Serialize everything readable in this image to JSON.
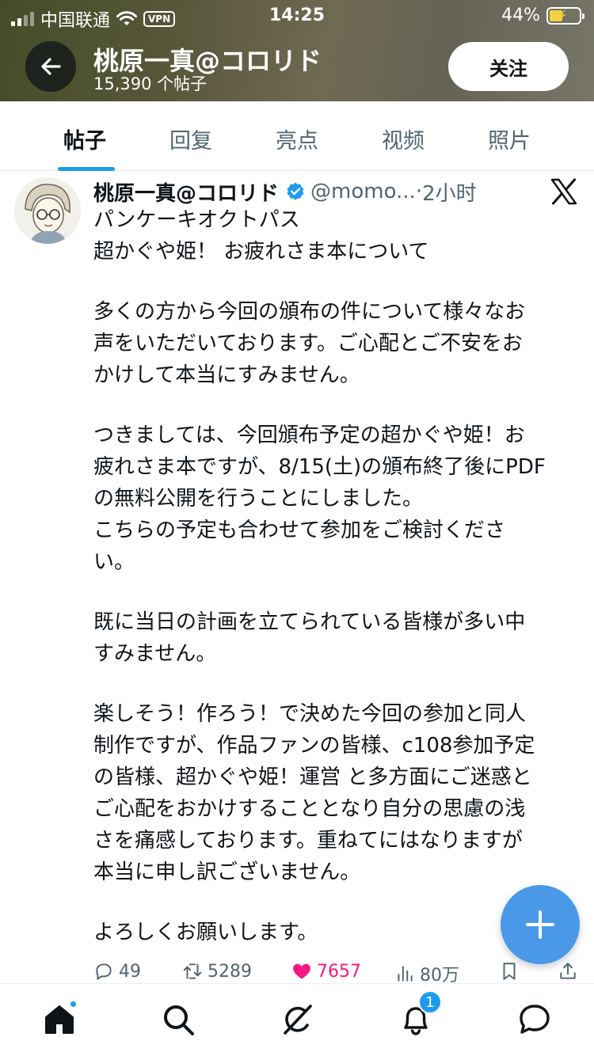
{
  "status_bar": {
    "carrier": "中国联通",
    "vpn": "VPN",
    "time": "14:25",
    "battery": "44%"
  },
  "header": {
    "profile_name": "桃原一真@コロリド",
    "post_count": "15,390 个帖子",
    "follow_label": "关注"
  },
  "tabs": [
    {
      "label": "帖子",
      "active": true
    },
    {
      "label": "回复",
      "active": false
    },
    {
      "label": "亮点",
      "active": false
    },
    {
      "label": "视频",
      "active": false
    },
    {
      "label": "照片",
      "active": false
    }
  ],
  "tweet": {
    "author": "桃原一真@コロリド",
    "handle": "@momo...",
    "dot": "·",
    "time": "2小时",
    "lines": [
      "パンケーキオクトパス",
      "超かぐや姫！ お疲れさま本について",
      "",
      "多くの方から今回の頒布の件について様々なお",
      "声をいただいております。ご心配とご不安をお",
      "かけして本当にすみません。",
      "",
      "つきましては、今回頒布予定の超かぐや姫！お",
      "疲れさま本ですが、8/15(土)の頒布終了後にPDF",
      "の無料公開を行うことにしました。",
      "こちらの予定も合わせて参加をご検討くださ",
      "い。",
      "",
      "既に当日の計画を立てられている皆様が多い中",
      "すみません。",
      "",
      "楽しそう！作ろう！で決めた今回の参加と同人",
      "制作ですが、作品ファンの皆様、c108参加予定",
      "の皆様、超かぐや姫！運営 と多方面にご迷惑と",
      "ご心配をおかけすることとなり自分の思慮の浅",
      "さを痛感しております。重ねてにはなりますが",
      "本当に申し訳ございません。",
      "",
      "よろしくお願いします。"
    ],
    "stats": {
      "replies": "49",
      "reposts": "5289",
      "likes": "7657",
      "views": "80万"
    }
  },
  "nav": {
    "notification_count": "1"
  },
  "colors": {
    "accent": "#1d9bf0",
    "fab": "#4a99e9",
    "like": "#f91880",
    "secondary_text": "#536471"
  },
  "icons": [
    "back-arrow-icon",
    "verified-icon",
    "x-logo-icon",
    "reply-icon",
    "repost-icon",
    "like-icon",
    "views-icon",
    "bookmark-icon",
    "share-icon",
    "plus-icon",
    "home-icon",
    "search-icon",
    "grok-icon",
    "bell-icon",
    "messages-icon"
  ]
}
